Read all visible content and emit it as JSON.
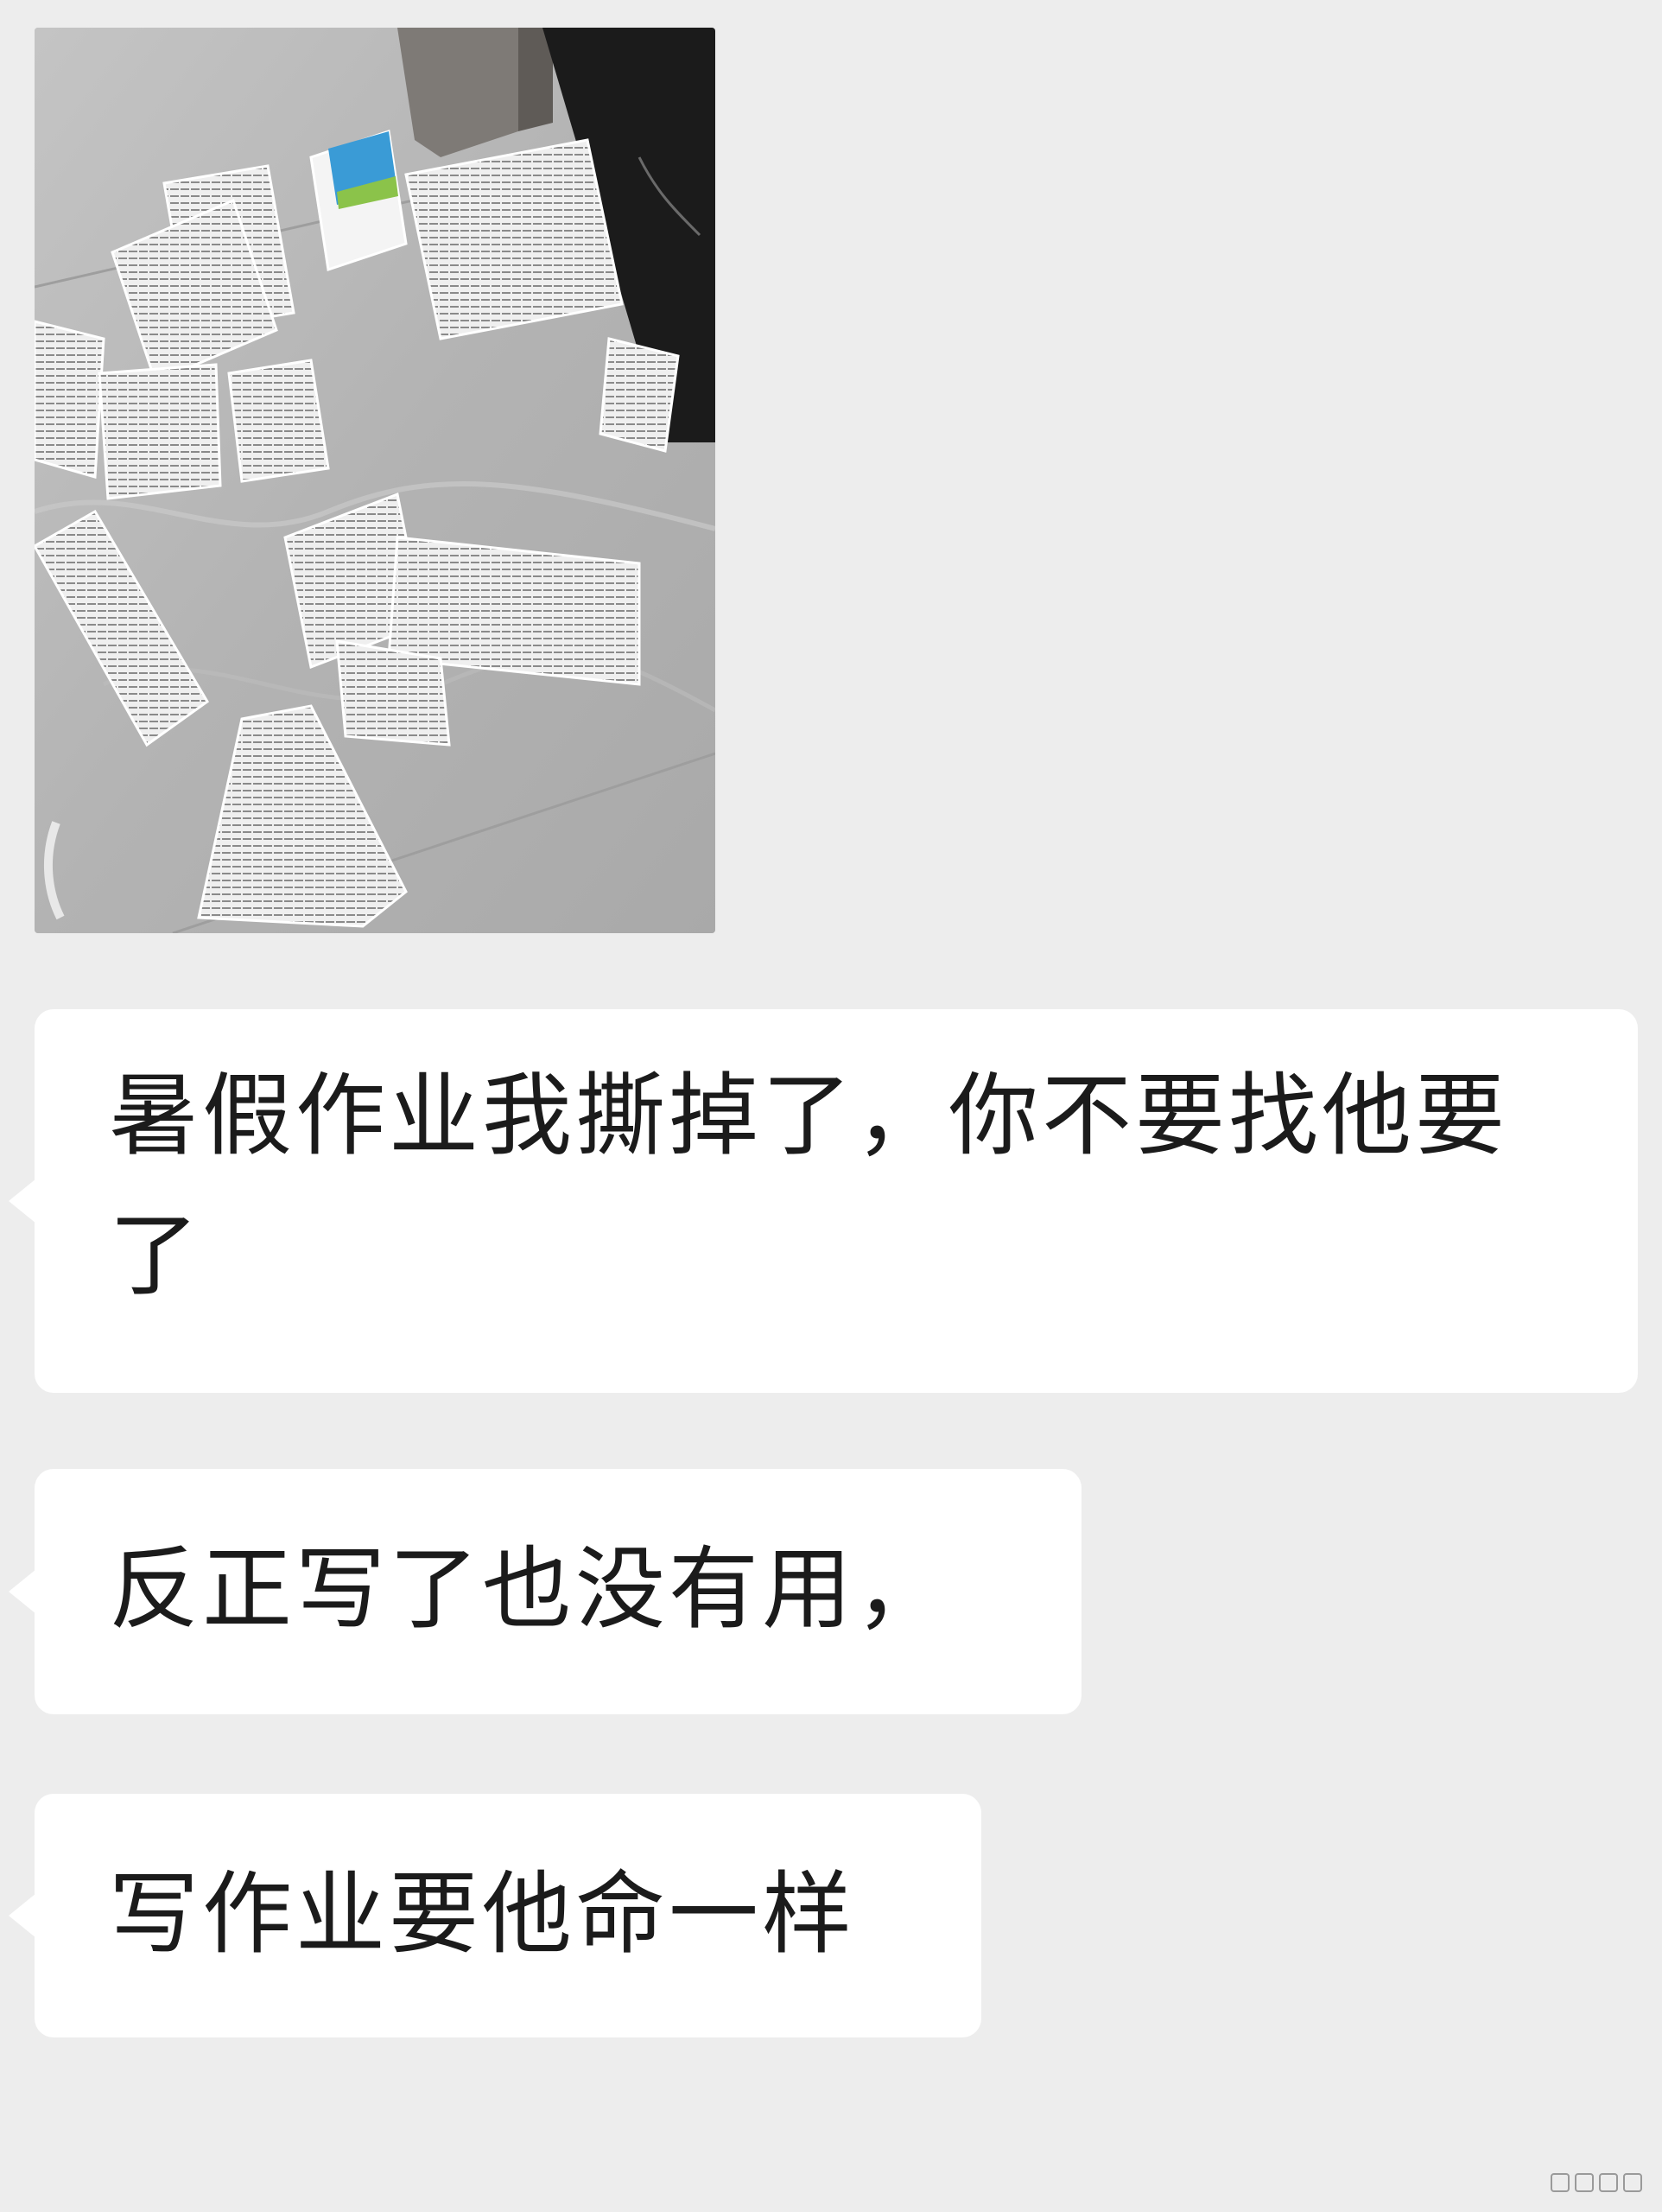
{
  "messages": [
    {
      "type": "image",
      "icon": "photo-torn-homework-on-floor"
    },
    {
      "type": "text",
      "text": "暑假作业我撕掉了，你不要找他要了"
    },
    {
      "type": "text",
      "text": "反正写了也没有用，"
    },
    {
      "type": "text",
      "text": "写作业要他命一样"
    }
  ],
  "colors": {
    "chat_background": "#ededed",
    "bubble_background": "#ffffff",
    "text": "#1b1b1b"
  }
}
